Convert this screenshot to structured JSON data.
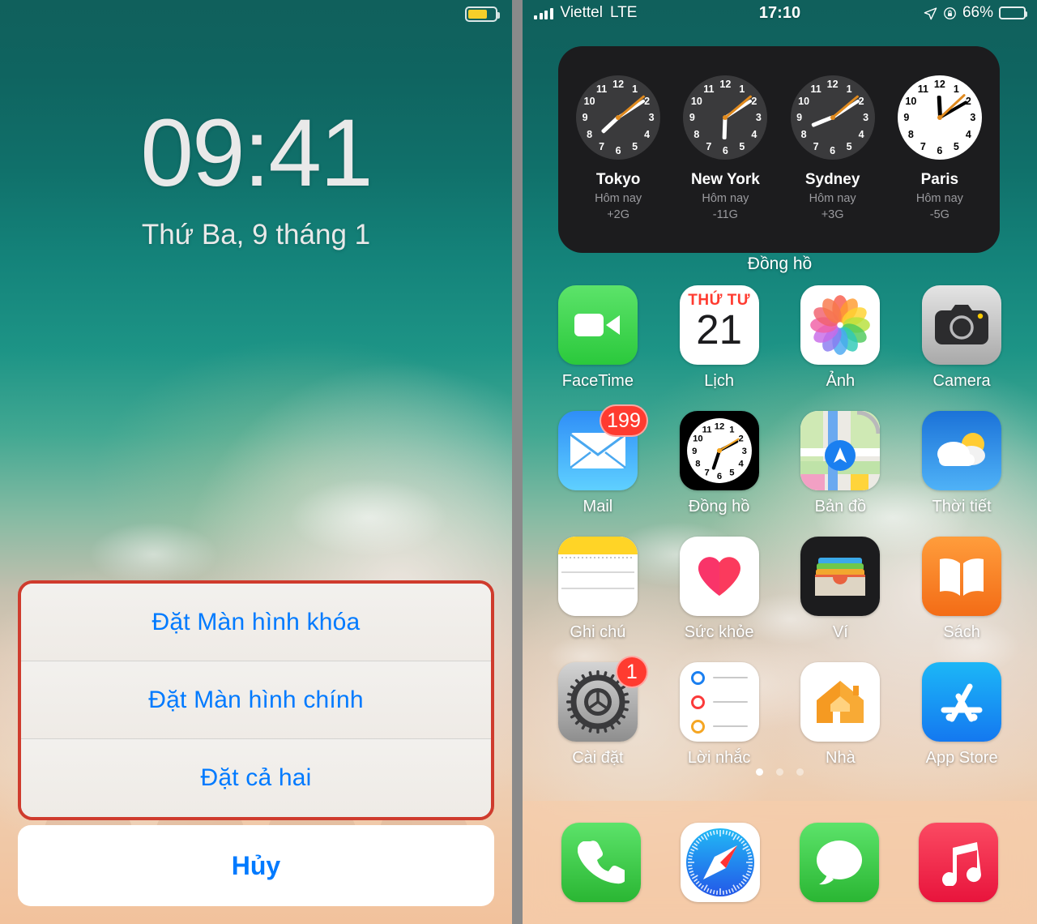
{
  "left": {
    "name": "lock-screen",
    "status": {
      "battery_icon": "battery-low-power-icon"
    },
    "time": "09:41",
    "date": "Thứ Ba, 9 tháng 1",
    "action_sheet": {
      "options": [
        "Đặt Màn hình khóa",
        "Đặt Màn hình chính",
        "Đặt cả hai"
      ],
      "cancel_label": "Hủy",
      "highlight_color": "#cf3b2d"
    }
  },
  "right": {
    "name": "home-screen",
    "status": {
      "signal_icon": "signal-bars-icon",
      "carrier": "Viettel",
      "network": "LTE",
      "time": "17:10",
      "location_icon": "location-arrow-icon",
      "rotation_lock_icon": "rotation-lock-icon",
      "battery_percent": "66%",
      "battery_icon": "battery-low-power-icon"
    },
    "widget": {
      "label": "Đồng hồ",
      "clocks": [
        {
          "city": "Tokyo",
          "day": "Hôm nay",
          "offset": "+2G",
          "face": "night",
          "hour_deg": 227,
          "minute_deg": 57,
          "second_deg": 50
        },
        {
          "city": "New York",
          "day": "Hôm nay",
          "offset": "-11G",
          "face": "night",
          "hour_deg": 182,
          "minute_deg": 57,
          "second_deg": 50
        },
        {
          "city": "Sydney",
          "day": "Hôm nay",
          "offset": "+3G",
          "face": "night",
          "hour_deg": 248,
          "minute_deg": 57,
          "second_deg": 50
        },
        {
          "city": "Paris",
          "day": "Hôm nay",
          "offset": "-5G",
          "face": "day",
          "hour_deg": 357,
          "minute_deg": 60,
          "second_deg": 47
        }
      ],
      "numerals": [
        "12",
        "1",
        "2",
        "3",
        "4",
        "5",
        "6",
        "7",
        "8",
        "9",
        "10",
        "11"
      ]
    },
    "apps": [
      {
        "label": "FaceTime",
        "icon": "facetime-icon",
        "badge": null
      },
      {
        "label": "Lịch",
        "icon": "calendar-icon",
        "badge": null,
        "cal_dow": "THỨ TƯ",
        "cal_day": "21"
      },
      {
        "label": "Ảnh",
        "icon": "photos-icon",
        "badge": null
      },
      {
        "label": "Camera",
        "icon": "camera-icon",
        "badge": null
      },
      {
        "label": "Mail",
        "icon": "mail-icon",
        "badge": "199"
      },
      {
        "label": "Đồng hồ",
        "icon": "clock-icon",
        "badge": null
      },
      {
        "label": "Bản đồ",
        "icon": "maps-icon",
        "badge": null
      },
      {
        "label": "Thời tiết",
        "icon": "weather-icon",
        "badge": null
      },
      {
        "label": "Ghi chú",
        "icon": "notes-icon",
        "badge": null
      },
      {
        "label": "Sức khỏe",
        "icon": "health-icon",
        "badge": null
      },
      {
        "label": "Ví",
        "icon": "wallet-icon",
        "badge": null
      },
      {
        "label": "Sách",
        "icon": "books-icon",
        "badge": null
      },
      {
        "label": "Cài đặt",
        "icon": "settings-icon",
        "badge": "1"
      },
      {
        "label": "Lời nhắc",
        "icon": "reminders-icon",
        "badge": null
      },
      {
        "label": "Nhà",
        "icon": "home-icon",
        "badge": null
      },
      {
        "label": "App Store",
        "icon": "appstore-icon",
        "badge": null
      }
    ],
    "page_dots": {
      "count": 3,
      "active_index": 0
    },
    "dock": [
      {
        "label": "Phone",
        "icon": "phone-icon"
      },
      {
        "label": "Safari",
        "icon": "safari-icon"
      },
      {
        "label": "Messages",
        "icon": "messages-icon"
      },
      {
        "label": "Music",
        "icon": "music-icon"
      }
    ]
  }
}
